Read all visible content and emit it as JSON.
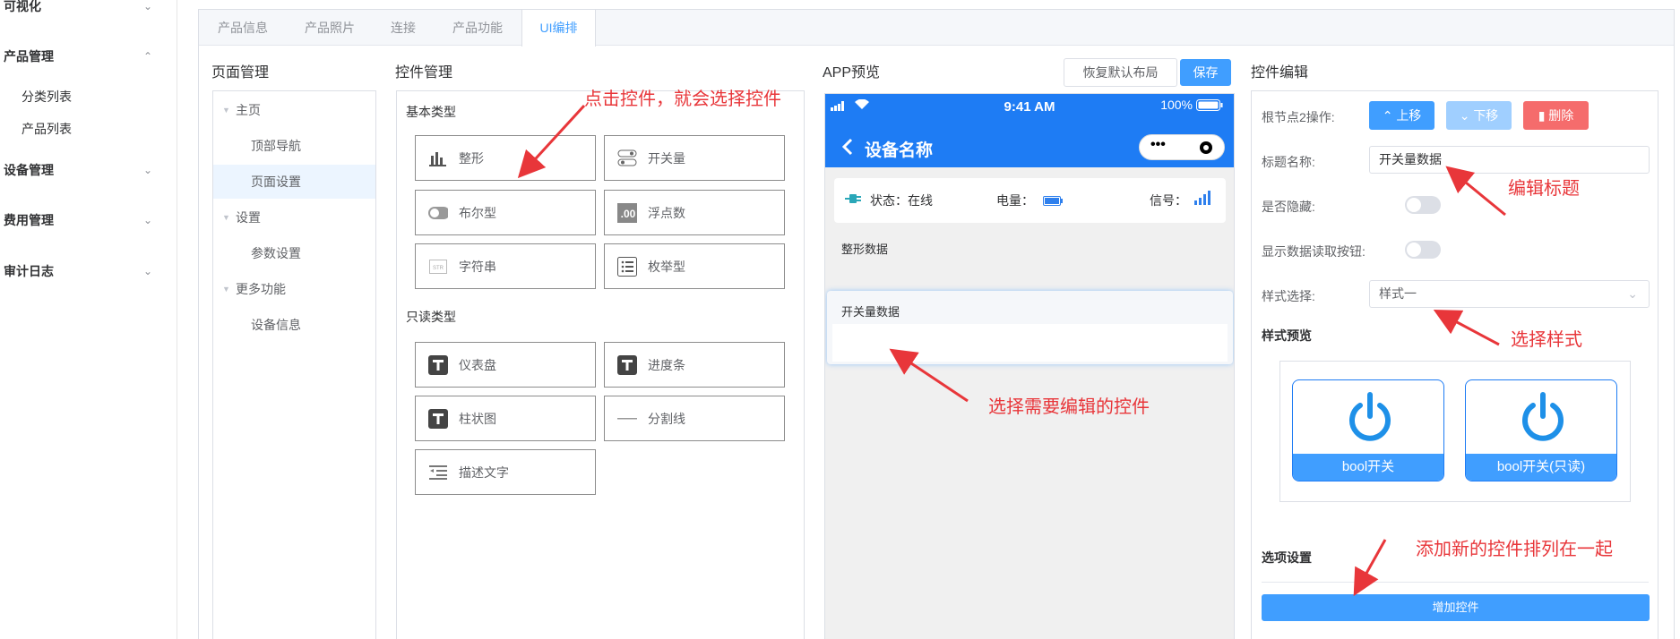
{
  "sidebar": {
    "visualize": "可视化",
    "product_mgmt": "产品管理",
    "category_list": "分类列表",
    "product_list": "产品列表",
    "device_mgmt": "设备管理",
    "fee_mgmt": "费用管理",
    "audit_log": "审计日志"
  },
  "tabs": [
    "产品信息",
    "产品照片",
    "连接",
    "产品功能",
    "UI编排"
  ],
  "page_mgmt": {
    "title": "页面管理",
    "nodes": [
      "主页",
      "顶部导航",
      "页面设置",
      "设置",
      "参数设置",
      "更多功能",
      "设备信息"
    ]
  },
  "ctrl_mgmt": {
    "title": "控件管理",
    "basic_label": "基本类型",
    "readonly_label": "只读类型",
    "basic": [
      "整形",
      "开关量",
      "布尔型",
      "浮点数",
      "字符串",
      "枚举型"
    ],
    "readonly": [
      "仪表盘",
      "进度条",
      "柱状图",
      "分割线",
      "描述文字"
    ]
  },
  "preview": {
    "title": "APP预览",
    "reset_btn": "恢复默认布局",
    "save_btn": "保存",
    "time": "9:41 AM",
    "battery": "100%",
    "device_name": "设备名称",
    "status": "状态：在线",
    "power": "电量：",
    "signal": "信号：",
    "int_data": "整形数据",
    "switch_data": "开关量数据"
  },
  "editor": {
    "title": "控件编辑",
    "node_op": "根节点2操作:",
    "up": "上移",
    "down": "下移",
    "delete": "删除",
    "title_label": "标题名称:",
    "title_value": "开关量数据",
    "hide_label": "是否隐藏:",
    "read_btn_label": "显示数据读取按钮:",
    "style_label": "样式选择:",
    "style_value": "样式一",
    "preview_label": "样式预览",
    "card1": "bool开关",
    "card2": "bool开关(只读)",
    "options_label": "选项设置",
    "add_btn": "增加控件"
  },
  "annotations": {
    "a1": "点击控件，就会选择控件",
    "a2": "选择需要编辑的控件",
    "a3": "编辑标题",
    "a4": "选择样式",
    "a5": "添加新的控件排列在一起"
  },
  "colors": {
    "primary": "#409eff",
    "phone_header": "#1e7cf4",
    "annotation": "#e8363a",
    "danger": "#f56c6c"
  }
}
